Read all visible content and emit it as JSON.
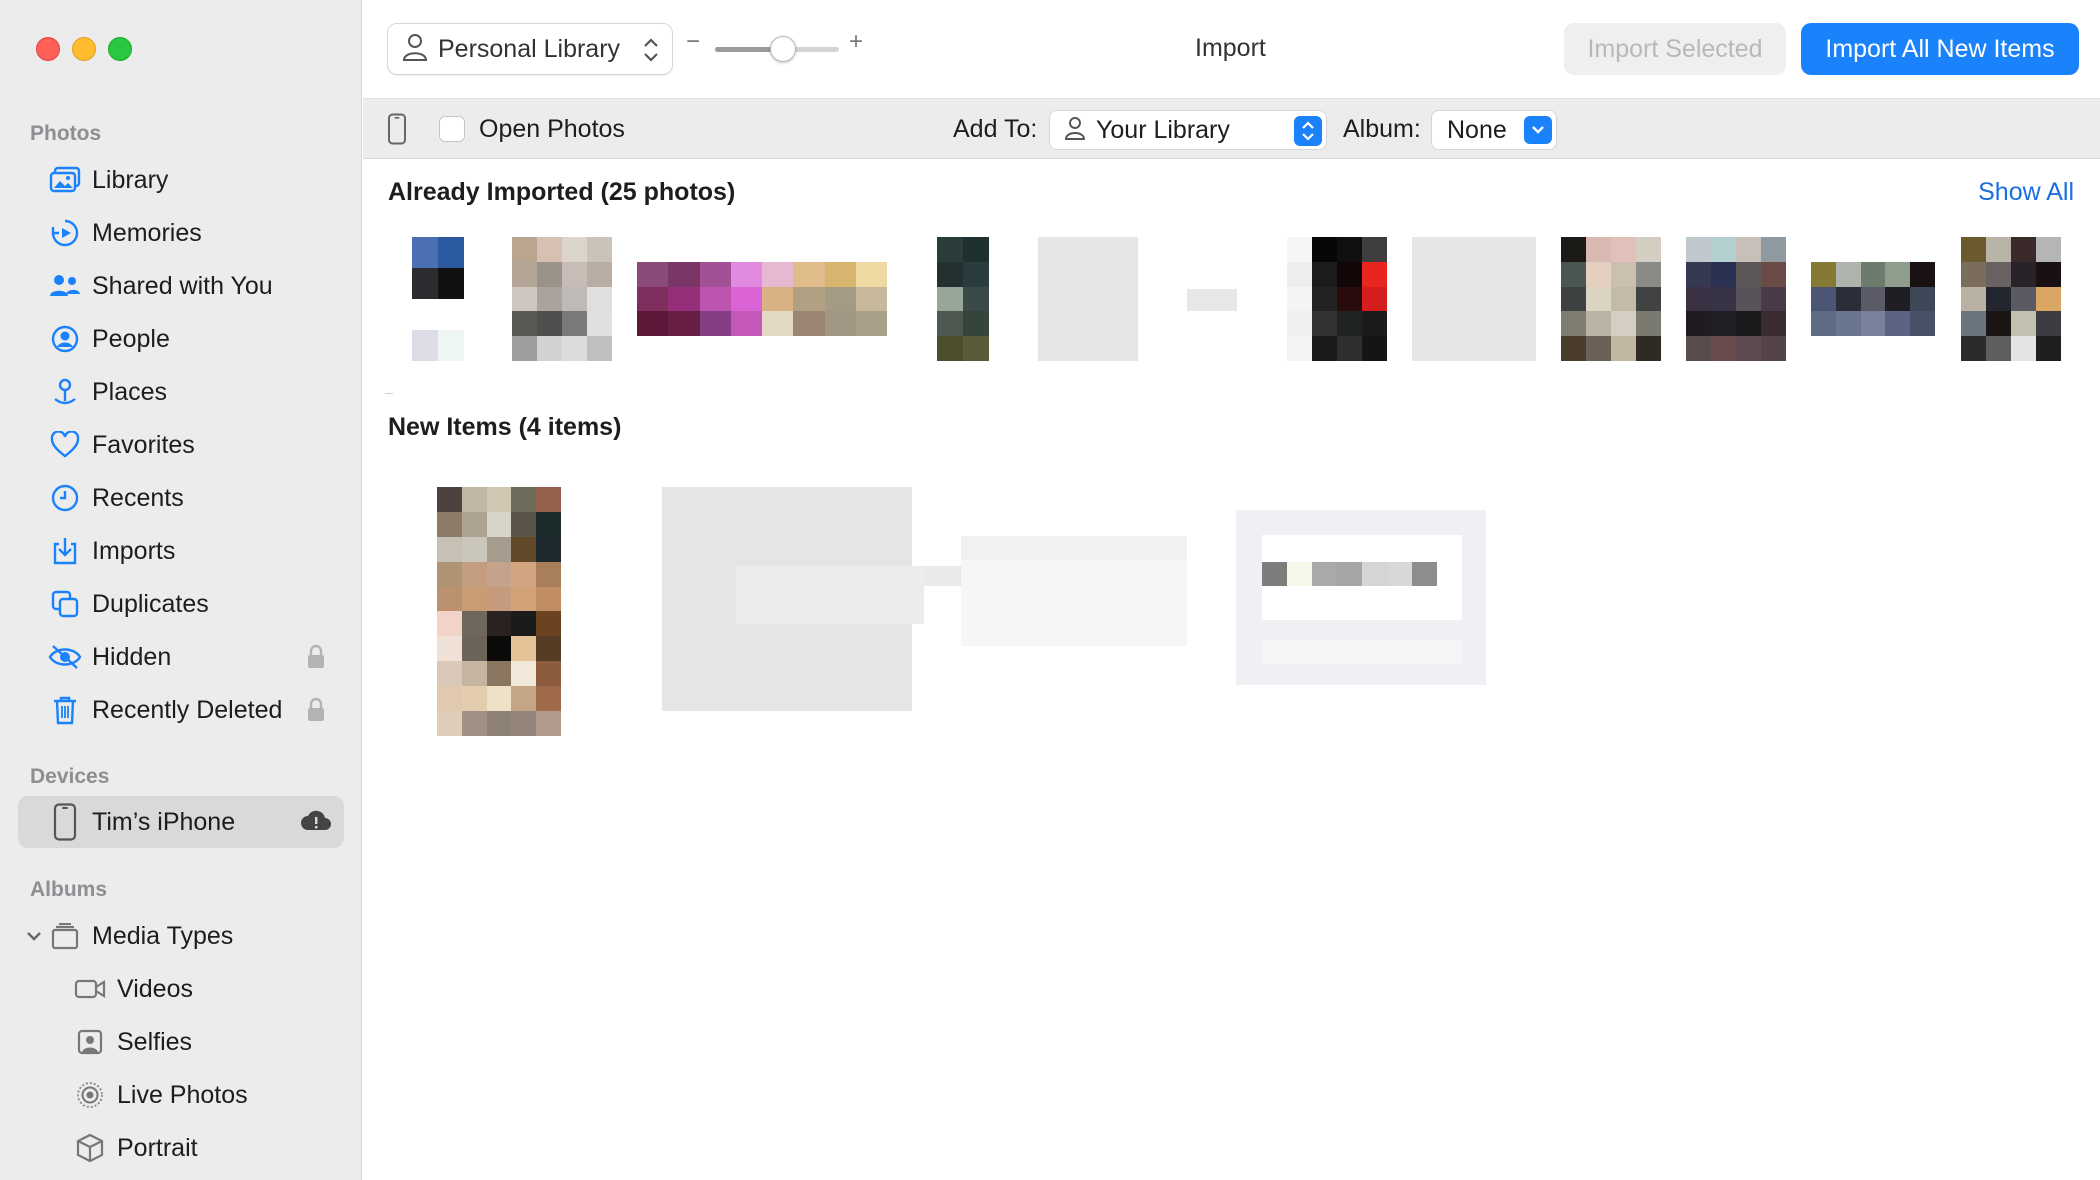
{
  "window": {
    "title": "Import"
  },
  "sidebar": {
    "photos_header": "Photos",
    "photos_items": [
      {
        "label": "Library",
        "icon": "photo-library-icon"
      },
      {
        "label": "Memories",
        "icon": "memories-icon"
      },
      {
        "label": "Shared with You",
        "icon": "shared-with-you-icon"
      },
      {
        "label": "People",
        "icon": "people-icon"
      },
      {
        "label": "Places",
        "icon": "places-icon"
      },
      {
        "label": "Favorites",
        "icon": "heart-icon"
      },
      {
        "label": "Recents",
        "icon": "clock-icon"
      },
      {
        "label": "Imports",
        "icon": "import-icon"
      },
      {
        "label": "Duplicates",
        "icon": "duplicates-icon"
      },
      {
        "label": "Hidden",
        "icon": "eye-slash-icon",
        "locked": true
      },
      {
        "label": "Recently Deleted",
        "icon": "trash-icon",
        "locked": true
      }
    ],
    "devices_header": "Devices",
    "device": {
      "label": "Tim’s iPhone",
      "icon": "iphone-icon",
      "status_icon": "cloud-alert-icon"
    },
    "albums_header": "Albums",
    "media_types": {
      "label": "Media Types",
      "icon": "stack-icon",
      "items": [
        {
          "label": "Videos",
          "icon": "video-icon"
        },
        {
          "label": "Selfies",
          "icon": "selfie-icon"
        },
        {
          "label": "Live Photos",
          "icon": "live-photo-icon"
        },
        {
          "label": "Portrait",
          "icon": "cube-icon"
        }
      ]
    }
  },
  "toolbar": {
    "library_picker": "Personal Library",
    "zoom_minus": "−",
    "zoom_plus": "+",
    "zoom_level": 0.55,
    "import_selected": "Import Selected",
    "import_all": "Import All New Items"
  },
  "options": {
    "open_photos": "Open Photos",
    "open_photos_checked": false,
    "add_to_label": "Add To:",
    "add_to_value": "Your Library",
    "album_label": "Album:",
    "album_value": "None"
  },
  "content": {
    "already_imported_title": "Already Imported (25 photos)",
    "show_all": "Show All",
    "new_items_title": "New Items (4 items)"
  },
  "colors": {
    "accent": "#1a82fb",
    "sidebar_bg": "#ececec",
    "selected_bg": "#d9d9d9"
  }
}
